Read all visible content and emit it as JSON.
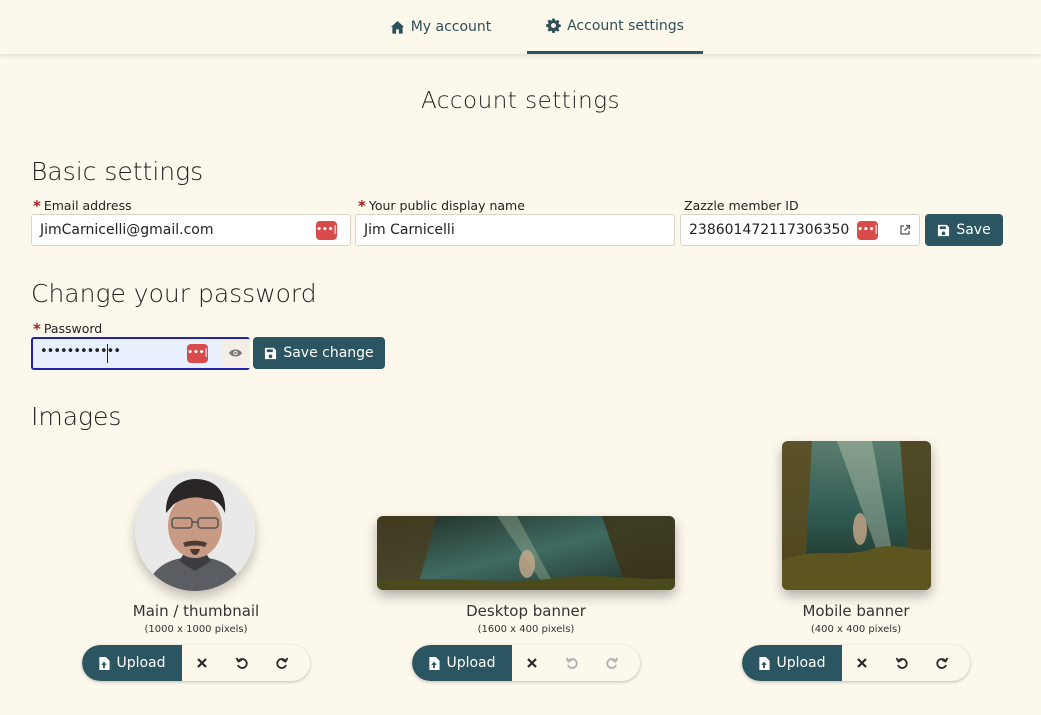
{
  "nav": {
    "tabs": [
      {
        "label": "My account",
        "icon": "home-icon"
      },
      {
        "label": "Account settings",
        "icon": "gear-icon",
        "active": true
      }
    ]
  },
  "page": {
    "title": "Account settings"
  },
  "basic": {
    "title": "Basic settings",
    "email": {
      "label": "Email address",
      "value": "JimCarnicelli@gmail.com",
      "required": true
    },
    "display_name": {
      "label": "Your public display name",
      "value": "Jim Carnicelli",
      "required": true
    },
    "member_id": {
      "label": "Zazzle member ID",
      "value": "238601472117306350"
    },
    "save_label": "Save"
  },
  "password": {
    "title": "Change your password",
    "label": "Password",
    "value": "••••••••••••",
    "save_label": "Save change"
  },
  "images": {
    "title": "Images",
    "items": [
      {
        "caption": "Main / thumbnail",
        "size": "(1000 x 1000 pixels)",
        "upload_label": "Upload"
      },
      {
        "caption": "Desktop banner",
        "size": "(1600 x 400 pixels)",
        "upload_label": "Upload"
      },
      {
        "caption": "Mobile banner",
        "size": "(400 x 400 pixels)",
        "upload_label": "Upload"
      }
    ]
  },
  "colors": {
    "accent": "#2b5560",
    "background": "#fdf8ec",
    "required": "#a32121",
    "password_manager": "#d94a4a"
  }
}
